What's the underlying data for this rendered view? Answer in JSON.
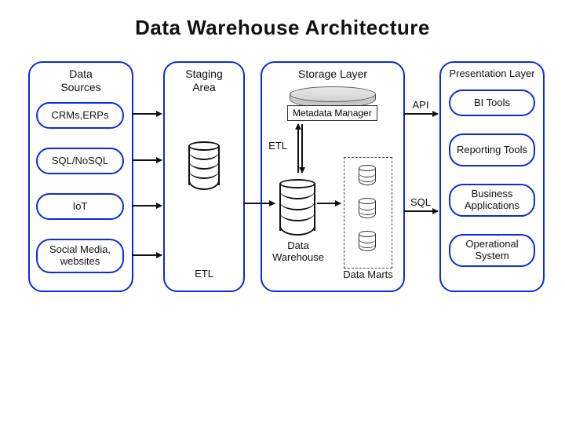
{
  "title": "Data Warehouse Architecture",
  "panels": {
    "sources": {
      "title": "Data\nSources",
      "items": [
        "CRMs,ERPs",
        "SQL/NoSQL",
        "IoT",
        "Social Media, websites"
      ]
    },
    "staging": {
      "title": "Staging\nArea",
      "bottomLabel": "ETL"
    },
    "storage": {
      "title": "Storage Layer",
      "metadata": "Metadata Manager",
      "etlLabel": "ETL",
      "dwLabel": "Data\nWarehouse",
      "martsLabel": "Data Marts"
    },
    "presentation": {
      "title": "Presentation Layer",
      "items": [
        "BI Tools",
        "Reporting Tools",
        "Business Applications",
        "Operational System"
      ]
    }
  },
  "connectors": {
    "api": "API",
    "sql": "SQL"
  }
}
